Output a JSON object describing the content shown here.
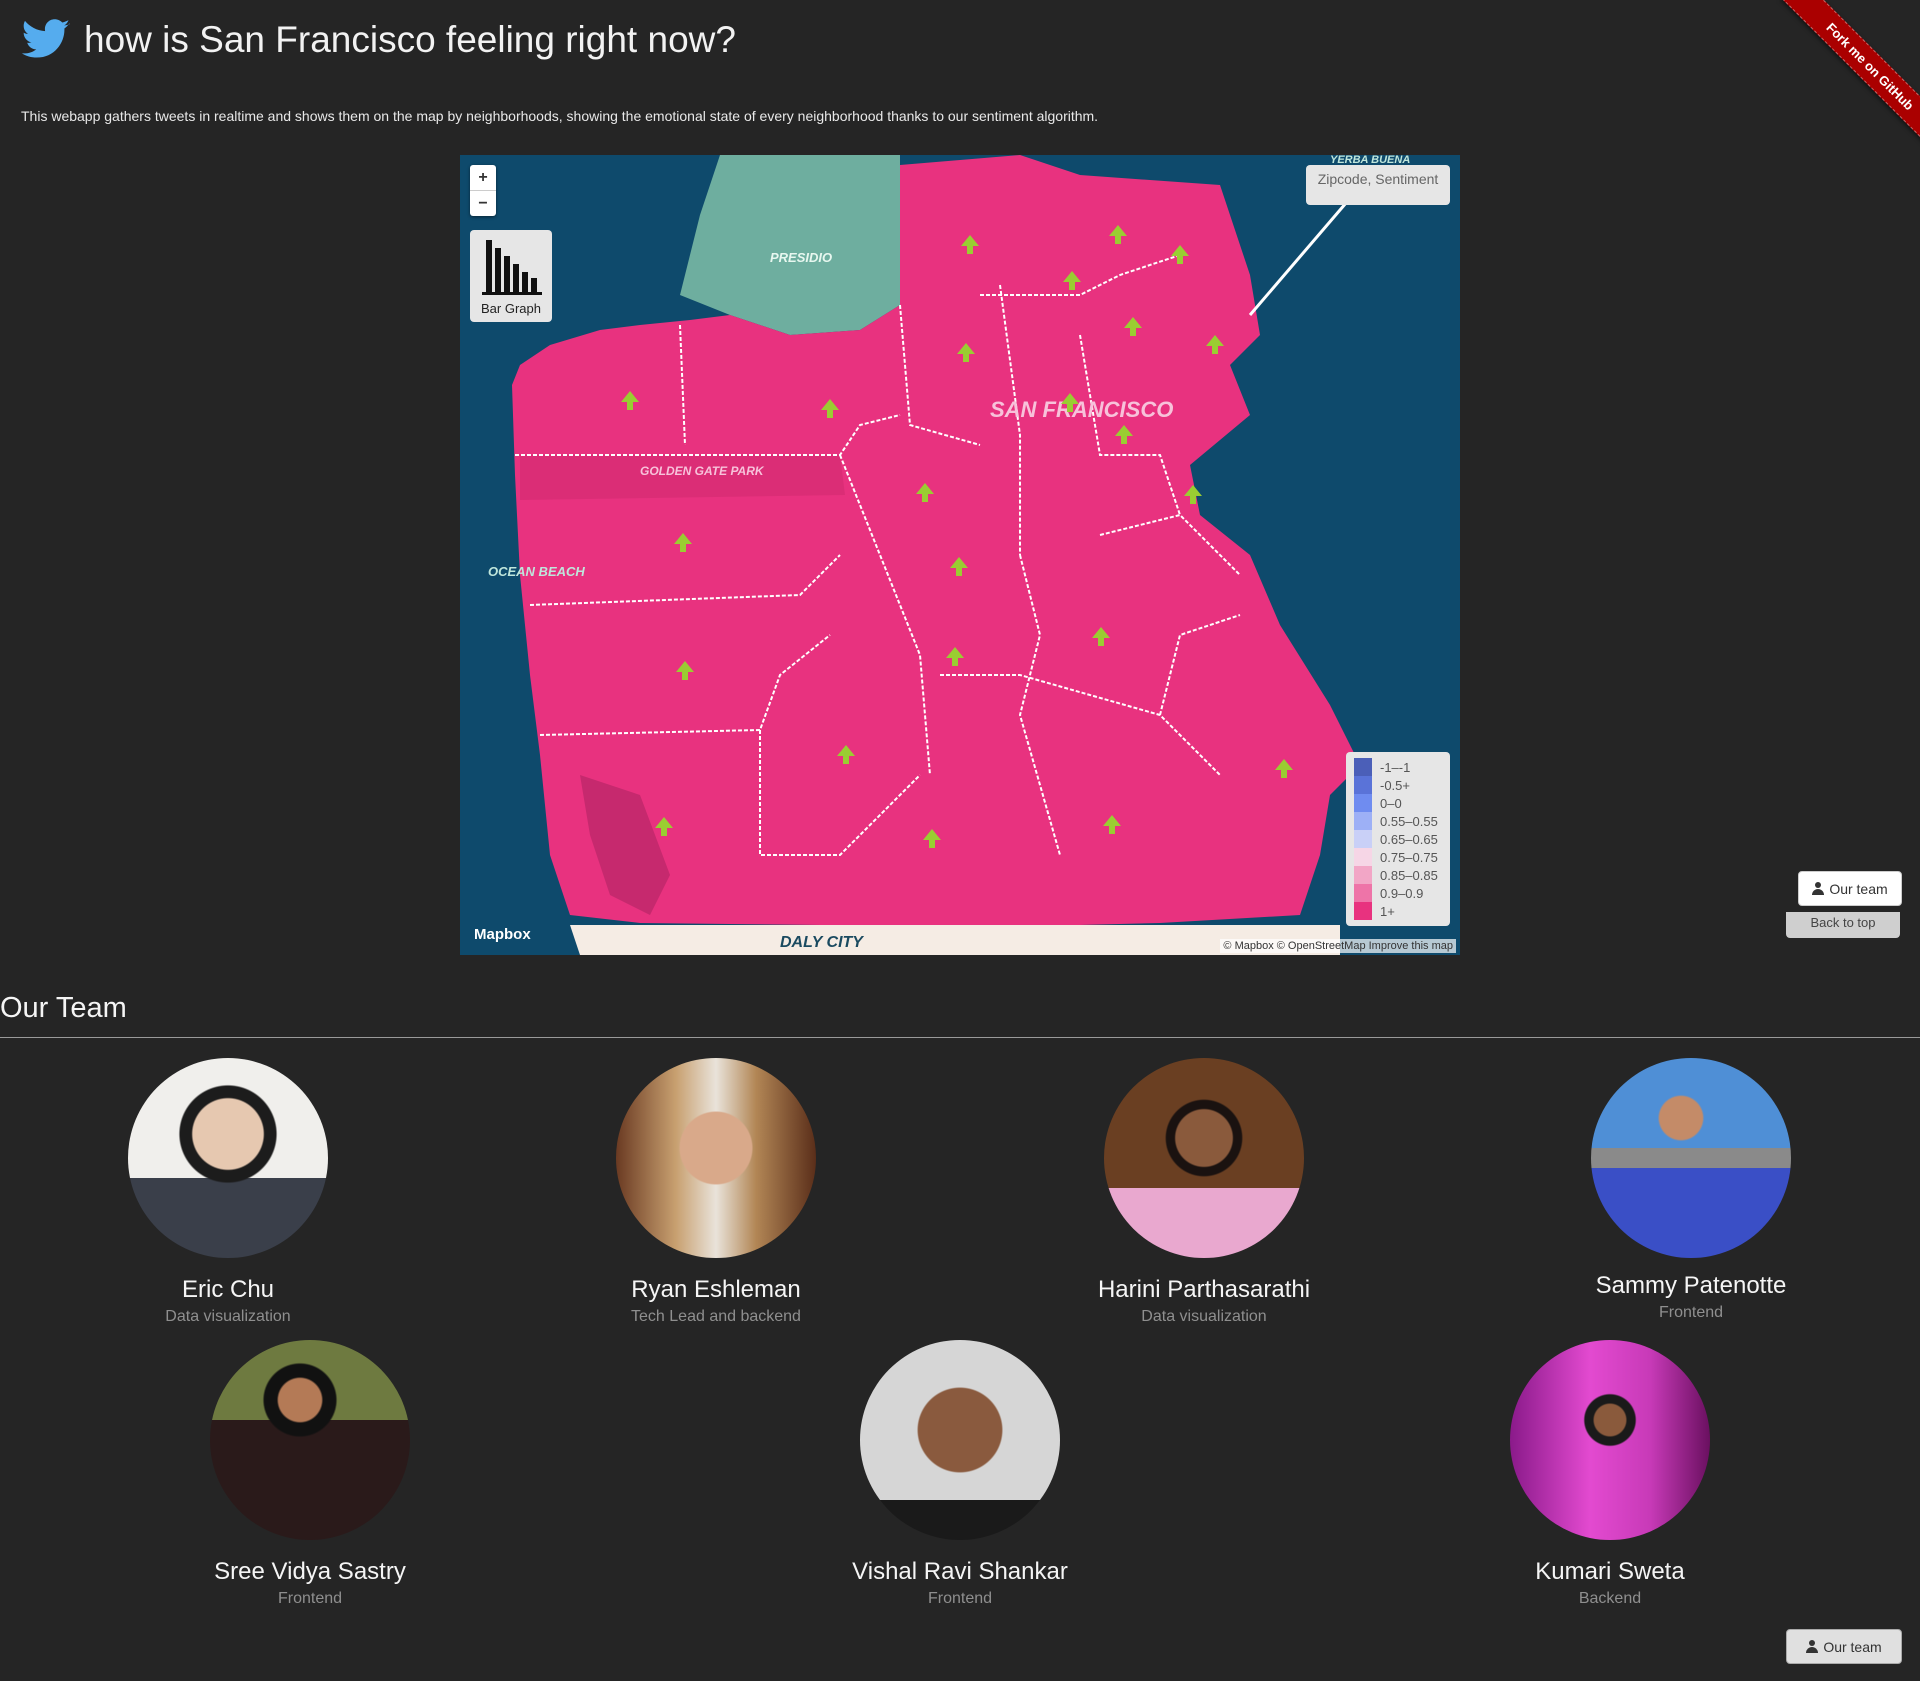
{
  "header": {
    "title": "how is San Francisco feeling right now?",
    "description": "This webapp gathers tweets in realtime and shows them on the map by neighborhoods, showing the emotional state of every neighborhood thanks to our sentiment algorithm.",
    "logo_icon": "twitter-bird-icon",
    "logo_color": "#55acee"
  },
  "ribbon": {
    "label": "Fork me on GitHub",
    "color": "#aa0000"
  },
  "map": {
    "zoom_in": "+",
    "zoom_out": "−",
    "bar_graph_label": "Bar Graph",
    "info_box": "Zipcode, Sentiment",
    "labels": [
      "PRESIDIO",
      "SAN FRANCISCO",
      "GOLDEN GATE PARK",
      "OCEAN BEACH",
      "DALY CITY",
      "YERBA BUENA"
    ],
    "land_color": "#e8327f",
    "water_color": "#0e4a6c",
    "marker_color": "#9acd32",
    "legend": [
      {
        "label": "-1–-1",
        "color": "#4b5fb8"
      },
      {
        "label": "-0.5+",
        "color": "#5a73d8"
      },
      {
        "label": "0–0",
        "color": "#6f8cf0"
      },
      {
        "label": "0.55–0.55",
        "color": "#9db0f6"
      },
      {
        "label": "0.65–0.65",
        "color": "#c9d0f7"
      },
      {
        "label": "0.75–0.75",
        "color": "#f6d6e6"
      },
      {
        "label": "0.85–0.85",
        "color": "#f2a6c6"
      },
      {
        "label": "0.9–0.9",
        "color": "#ee74a8"
      },
      {
        "label": "1+",
        "color": "#e8327f"
      }
    ],
    "mapbox_logo": "Mapbox",
    "attribution": "© Mapbox © OpenStreetMap Improve this map"
  },
  "buttons": {
    "our_team": "Our team",
    "back_to_top": "Back to top"
  },
  "team": {
    "title": "Our Team",
    "members": [
      {
        "name": "Eric Chu",
        "role": "Data visualization"
      },
      {
        "name": "Ryan Eshleman",
        "role": "Tech Lead and backend"
      },
      {
        "name": "Harini Parthasarathi",
        "role": "Data visualization"
      },
      {
        "name": "Sammy Patenotte",
        "role": "Frontend"
      },
      {
        "name": "Sree Vidya Sastry",
        "role": "Frontend"
      },
      {
        "name": "Vishal Ravi Shankar",
        "role": "Frontend"
      },
      {
        "name": "Kumari Sweta",
        "role": "Backend"
      }
    ]
  }
}
